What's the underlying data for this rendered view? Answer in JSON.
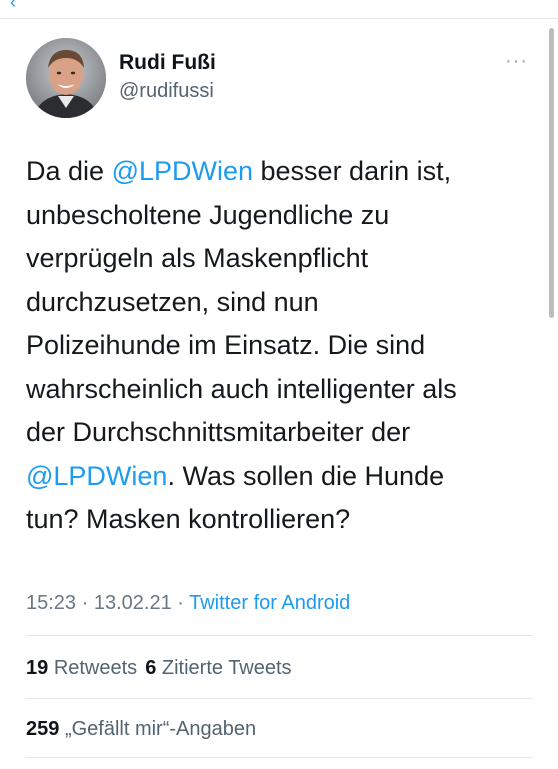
{
  "top_glyph": "‹",
  "author": {
    "display_name": "Rudi Fußi",
    "handle": "@rudifussi"
  },
  "more_icon": "···",
  "tweet": {
    "lines": [
      [
        {
          "t": "Da die ",
          "m": false
        },
        {
          "t": "@LPDWien",
          "m": true
        },
        {
          "t": " besser darin ist,",
          "m": false
        }
      ],
      [
        {
          "t": "unbescholtene Jugendliche zu",
          "m": false
        }
      ],
      [
        {
          "t": "verprügeln als Maskenpflicht",
          "m": false
        }
      ],
      [
        {
          "t": "durchzusetzen, sind nun",
          "m": false
        }
      ],
      [
        {
          "t": "Polizeihunde im Einsatz. Die sind",
          "m": false
        }
      ],
      [
        {
          "t": "wahrscheinlich auch intelligenter als",
          "m": false
        }
      ],
      [
        {
          "t": "der Durchschnittsmitarbeiter der",
          "m": false
        }
      ],
      [
        {
          "t": "@LPDWien",
          "m": true
        },
        {
          "t": ". Was sollen die Hunde",
          "m": false
        }
      ],
      [
        {
          "t": "tun? Masken kontrollieren?",
          "m": false
        }
      ]
    ]
  },
  "meta": {
    "time": "15:23",
    "date": "13.02.21",
    "separator": " · ",
    "source": "Twitter for Android"
  },
  "stats": {
    "retweets_count": "19",
    "retweets_label": "Retweets",
    "quotes_count": "6",
    "quotes_label": "Zitierte Tweets",
    "likes_count": "259",
    "likes_label": "„Gefällt mir“-Angaben"
  },
  "colors": {
    "accent": "#1d9bf0",
    "text": "#0f1419",
    "secondary": "#536471"
  }
}
